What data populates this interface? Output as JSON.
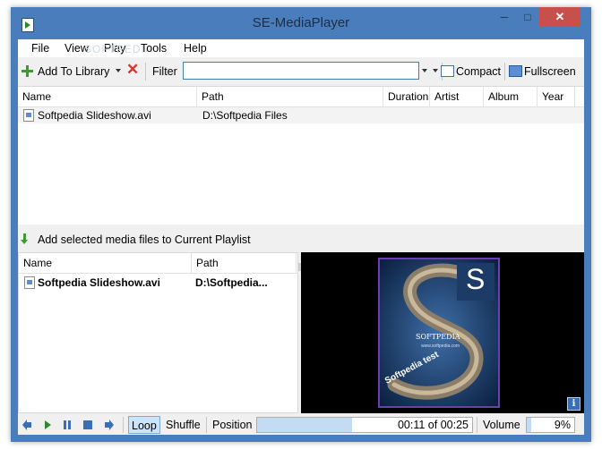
{
  "window": {
    "title": "SE-MediaPlayer",
    "minimize": "─",
    "maximize": "□",
    "close": "✕",
    "watermark": "SOFTPEDIA"
  },
  "menu": [
    "File",
    "View",
    "Play",
    "Tools",
    "Help"
  ],
  "toolbar": {
    "add_to_library": "Add To Library",
    "filter_label": "Filter",
    "filter_value": "",
    "compact": "Compact",
    "fullscreen": "Fullscreen"
  },
  "library": {
    "columns": [
      "Name",
      "Path",
      "Duration",
      "Artist",
      "Album",
      "Year"
    ],
    "rows": [
      {
        "name": "Softpedia Slideshow.avi",
        "path": "D:\\Softpedia Files",
        "duration": "",
        "artist": "",
        "album": "",
        "year": ""
      }
    ]
  },
  "add_selected": "Add selected media files to Current Playlist",
  "playlist": {
    "columns": [
      "Name",
      "Path"
    ],
    "rows": [
      {
        "name": "Softpedia Slideshow.avi",
        "path": "D:\\Softpedia..."
      }
    ]
  },
  "video": {
    "logo_letter": "S",
    "caption1": "SOFTPEDIA",
    "caption2": "www.softpedia.com",
    "tagline": "Softpedia test",
    "info": "i"
  },
  "controls": {
    "loop": "Loop",
    "shuffle": "Shuffle",
    "position_label": "Position",
    "position_text": "00:11 of 00:25",
    "position_fraction": 0.44,
    "volume_label": "Volume",
    "volume_text": "9%",
    "volume_fraction": 0.09
  },
  "colors": {
    "accent": "#4a7dbb",
    "close_button": "#c7504c",
    "selection": "#cfe3f7"
  }
}
